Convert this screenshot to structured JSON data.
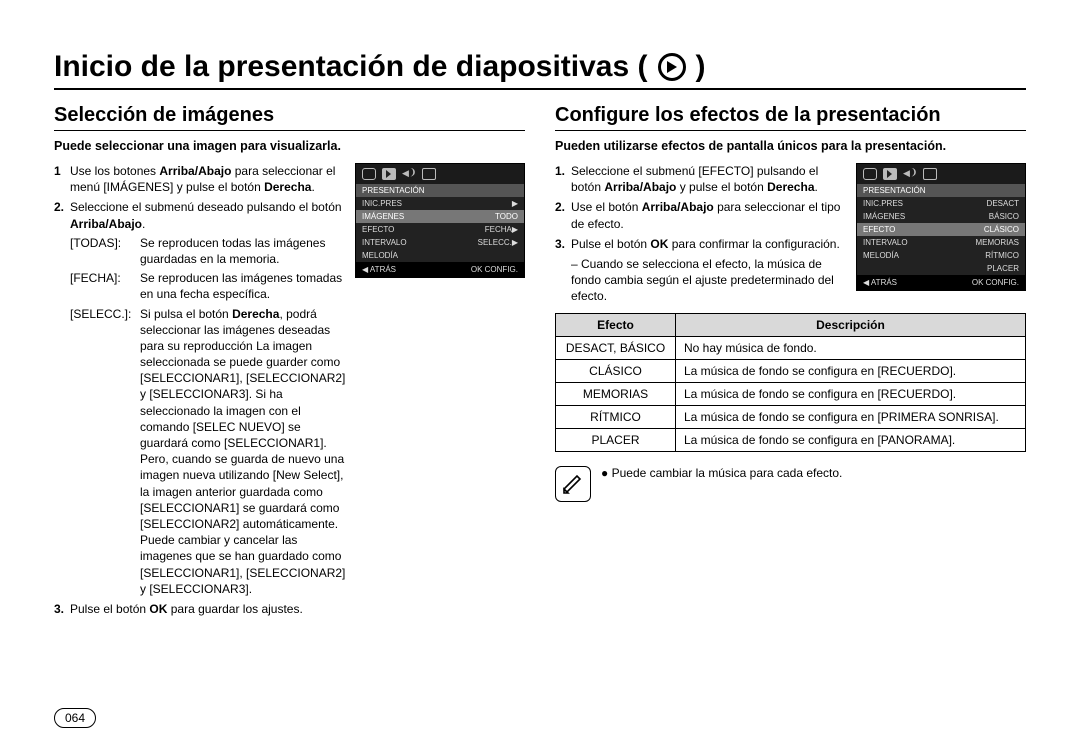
{
  "main_title": "Inicio de la presentación de diapositivas (",
  "main_title_close": ")",
  "left": {
    "heading": "Selección de imágenes",
    "intro": "Puede seleccionar una imagen para visualizarla.",
    "step1_a": "Use los botones ",
    "step1_b": "Arriba/Abajo",
    "step1_c": " para seleccionar el menú [IMÁGENES] y pulse el botón ",
    "step1_d": "Derecha",
    "step1_e": ".",
    "step2_a": "Seleccione el submenú deseado pulsando el botón ",
    "step2_b": "Arriba/Abajo",
    "step2_c": ".",
    "t_todas_l": "[TODAS]:",
    "t_todas_d": "Se reproducen todas las imágenes guardadas en la memoria.",
    "t_fecha_l": "[FECHA]:",
    "t_fecha_d": "Se reproducen las imágenes tomadas en una fecha específica.",
    "t_selec_l": "[SELECC.]:",
    "t_selec_d_a": "Si pulsa el botón ",
    "t_selec_d_b": "Derecha",
    "t_selec_d_c": ", podrá seleccionar las imágenes deseadas para su reproducción La imagen seleccionada se puede guarder como [SELECCIONAR1], [SELECCIONAR2] y [SELECCIONAR3]. Si ha seleccionado la imagen con el comando [SELEC NUEVO] se guardará como [SELECCIONAR1]. Pero, cuando se guarda de nuevo una imagen nueva utilizando [New Select], la imagen anterior guardada como [SELECCIONAR1] se guardará como [SELECCIONAR2] automáticamente. Puede cambiar y cancelar las imagenes que se han guardado como [SELECCIONAR1], [SELECCIONAR2] y [SELECCIONAR3].",
    "step3_a": "Pulse el botón ",
    "step3_b": "OK",
    "step3_c": " para guardar los ajustes.",
    "screen": {
      "head": "PRESENTACIÓN",
      "r1l": "INIC.PRES",
      "r1r": "▶",
      "r2l": "IMÁGENES",
      "r2r": "TODO",
      "r3l": "EFECTO",
      "r3r": "FECHA▶",
      "r4l": "INTERVALO",
      "r4r": "SELECC.▶",
      "r5l": "MELODÍA",
      "r5r": "",
      "bl": "◀ ATRÁS",
      "br": "OK CONFIG."
    }
  },
  "right": {
    "heading": "Configure los efectos de la presentación",
    "intro": "Pueden utilizarse efectos de pantalla únicos para la presentación.",
    "step1_a": "Seleccione el submenú [EFECTO] pulsando el botón ",
    "step1_b": "Arriba/Abajo",
    "step1_c": " y pulse el botón ",
    "step1_d": "Derecha",
    "step1_e": ".",
    "step2_a": "Use el botón ",
    "step2_b": "Arriba/Abajo",
    "step2_c": " para seleccionar el tipo de efecto.",
    "step3_a": "Pulse el botón ",
    "step3_b": "OK",
    "step3_c": " para confirmar la configuración.",
    "sub_note": "– Cuando se selecciona el efecto, la música de fondo cambia según el ajuste predeterminado del efecto.",
    "table": {
      "h1": "Efecto",
      "h2": "Descripción",
      "r1c1": "DESACT, BÁSICO",
      "r1c2": "No hay música de fondo.",
      "r2c1": "CLÁSICO",
      "r2c2": "La música de fondo se configura en [RECUERDO].",
      "r3c1": "MEMORIAS",
      "r3c2": "La música de fondo se configura en [RECUERDO].",
      "r4c1": "RÍTMICO",
      "r4c2": "La música de fondo se configura en [PRIMERA SONRISA].",
      "r5c1": "PLACER",
      "r5c2": "La música de fondo se configura en [PANORAMA]."
    },
    "note": "Puede cambiar la música para cada efecto.",
    "screen": {
      "head": "PRESENTACIÓN",
      "r1l": "INIC.PRES",
      "r1r": "DESACT",
      "r2l": "IMÁGENES",
      "r2r": "BÁSICO",
      "r3l": "EFECTO",
      "r3r": "CLÁSICO",
      "r4l": "INTERVALO",
      "r4r": "MEMORIAS",
      "r5l": "MELODÍA",
      "r5r": "RÍTMICO",
      "r6l": "",
      "r6r": "PLACER",
      "bl": "◀ ATRÁS",
      "br": "OK CONFIG."
    }
  },
  "page_num": "064"
}
